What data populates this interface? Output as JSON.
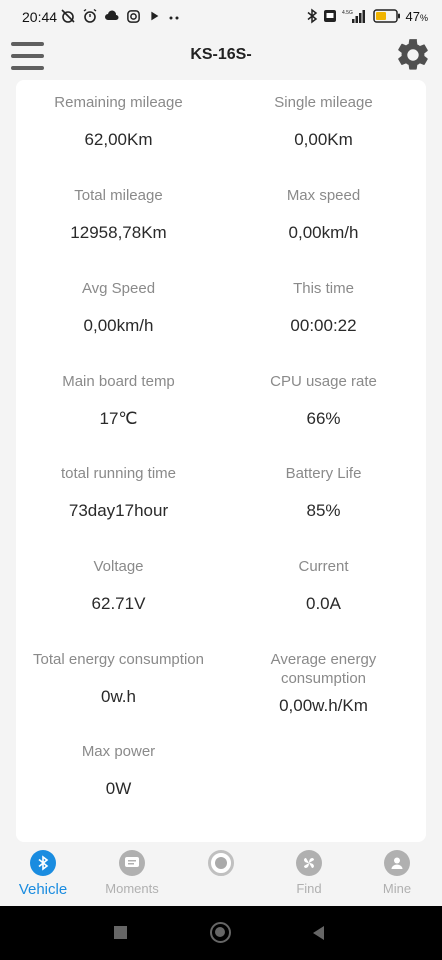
{
  "status_bar": {
    "time": "20:44",
    "battery_percent": "47",
    "percent_sign": "%",
    "network": "4.5G"
  },
  "app_bar": {
    "title": "KS-16S-"
  },
  "stats": [
    {
      "label": "Remaining mileage",
      "value": "62,00Km"
    },
    {
      "label": "Single mileage",
      "value": "0,00Km"
    },
    {
      "label": "Total mileage",
      "value": "12958,78Km"
    },
    {
      "label": "Max speed",
      "value": "0,00km/h"
    },
    {
      "label": "Avg Speed",
      "value": "0,00km/h"
    },
    {
      "label": "This time",
      "value": "00:00:22"
    },
    {
      "label": "Main board temp",
      "value": "17℃"
    },
    {
      "label": "CPU usage rate",
      "value": "66%"
    },
    {
      "label": "total running time",
      "value": "73day17hour"
    },
    {
      "label": "Battery Life",
      "value": "85%"
    },
    {
      "label": "Voltage",
      "value": "62.71V"
    },
    {
      "label": "Current",
      "value": "0.0A"
    },
    {
      "label": "Total energy consumption",
      "value": "0w.h"
    },
    {
      "label_line1": "Average energy",
      "label_line2": "consumption",
      "value": "0,00w.h/Km"
    },
    {
      "label": "Max power",
      "value": "0W"
    }
  ],
  "bottom_nav": [
    {
      "label": "Vehicle",
      "icon": "bluetooth-icon",
      "active": true
    },
    {
      "label": "Moments",
      "icon": "chat-icon",
      "active": false
    },
    {
      "label": "",
      "icon": "record-icon",
      "active": false
    },
    {
      "label": "Find",
      "icon": "fan-icon",
      "active": false
    },
    {
      "label": "Mine",
      "icon": "person-icon",
      "active": false
    }
  ],
  "colors": {
    "accent": "#1a8ce0",
    "label": "#8a8a8a",
    "value": "#2a2a2a",
    "inactive": "#b0b0b0"
  }
}
